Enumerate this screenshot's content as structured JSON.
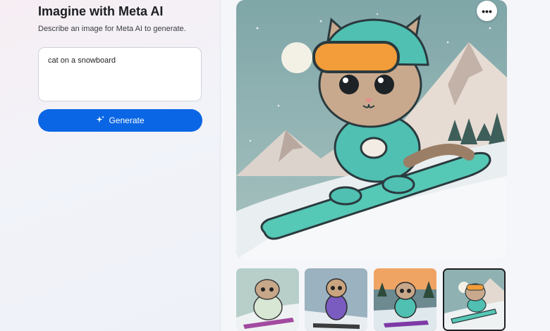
{
  "panel": {
    "title": "Imagine with Meta AI",
    "subtitle": "Describe an image for Meta AI to generate."
  },
  "prompt": {
    "value": "cat on a snowboard"
  },
  "generate_button": {
    "label": "Generate",
    "icon": "sparkle-icon",
    "color": "#0a66e4"
  },
  "main_image": {
    "more_icon": "more-horizontal-icon",
    "more_glyph": "•••"
  },
  "thumbnails": [
    {
      "selected": false
    },
    {
      "selected": false
    },
    {
      "selected": false
    },
    {
      "selected": true
    }
  ]
}
